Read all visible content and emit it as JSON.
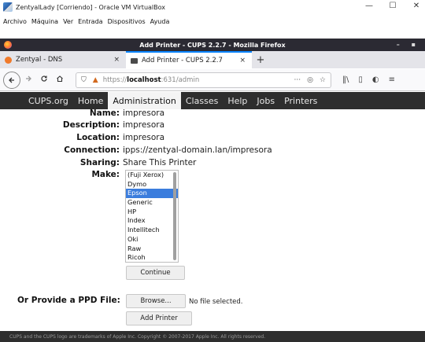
{
  "vbox": {
    "title": "ZentyalLady [Corriendo] - Oracle VM VirtualBox",
    "menu": [
      "Archivo",
      "Máquina",
      "Ver",
      "Entrada",
      "Dispositivos",
      "Ayuda"
    ],
    "controls": [
      "—",
      "☐",
      "✕"
    ]
  },
  "firefox": {
    "window_title": "Add Printer - CUPS 2.2.7 - Mozilla Firefox",
    "tabs": [
      {
        "label": "Zentyal - DNS",
        "close": "×"
      },
      {
        "label": "Add Printer - CUPS 2.2.7",
        "close": "×"
      }
    ],
    "new_tab": "+",
    "url_prefix": "https://",
    "url_host": "localhost",
    "url_path": ":631/admin",
    "url_more": "···"
  },
  "cups_nav": [
    "CUPS.org",
    "Home",
    "Administration",
    "Classes",
    "Help",
    "Jobs",
    "Printers"
  ],
  "fields": [
    {
      "label": "Name:",
      "value": "impresora"
    },
    {
      "label": "Description:",
      "value": "impresora"
    },
    {
      "label": "Location:",
      "value": "impresora"
    },
    {
      "label": "Connection:",
      "value": "ipps://zentyal-domain.lan/impresora"
    },
    {
      "label": "Sharing:",
      "value": "Share This Printer"
    }
  ],
  "make": {
    "label": "Make:",
    "options": [
      "(Fuji Xerox)",
      "Dymo",
      "Epson",
      "Generic",
      "HP",
      "Index",
      "Intellitech",
      "Oki",
      "Raw",
      "Ricoh"
    ],
    "selected": "Epson"
  },
  "buttons": {
    "continue": "Continue",
    "browse": "Browse...",
    "add_printer": "Add Printer"
  },
  "ppd": {
    "label": "Or Provide a PPD File:",
    "no_file": "No file selected."
  },
  "footer": "CUPS and the CUPS logo are trademarks of Apple Inc. Copyright © 2007-2017 Apple Inc. All rights reserved.",
  "colors": {
    "firefox_titlebar": "#2b2a33",
    "cups_nav_bg": "#2e2e2e",
    "selected_option": "#3b7ddd",
    "active_tab_accent": "#0a84ff"
  }
}
